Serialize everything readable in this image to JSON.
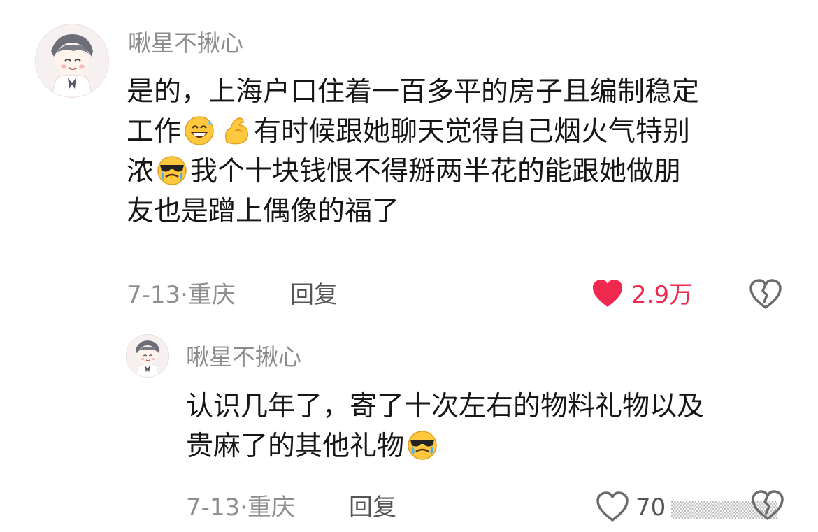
{
  "comment": {
    "username": "啾星不揪心",
    "lines": [
      [
        "是的，上海户口住着一百多平的房子且编制稳定"
      ],
      [
        "工作",
        "grinning-sweat-emoji",
        "flexed-bicep-emoji",
        "有时候跟她聊天觉得自己烟火气特别"
      ],
      [
        "浓",
        "cool-crying-emoji",
        "我个十块钱恨不得掰两半花的能跟她做朋"
      ],
      [
        "友也是蹭上偶像的福了"
      ]
    ],
    "date": "7-13",
    "location": "重庆",
    "reply_label": "回复",
    "like_count": "2.9万",
    "liked": true
  },
  "reply": {
    "username": "啾星不揪心",
    "lines": [
      [
        "认识几年了，寄了十次左右的物料礼物以及"
      ],
      [
        "贵麻了的其他礼物",
        "cool-crying-emoji"
      ]
    ],
    "date": "7-13",
    "location": "重庆",
    "reply_label": "回复",
    "like_count": "70",
    "liked": false
  },
  "watermark": "▒▒▒▒▒▒▒▒▒",
  "colors": {
    "like_red": "#f0294e",
    "username_gray": "#8c8c8c",
    "emoji_yellow": "#ffc83d"
  }
}
